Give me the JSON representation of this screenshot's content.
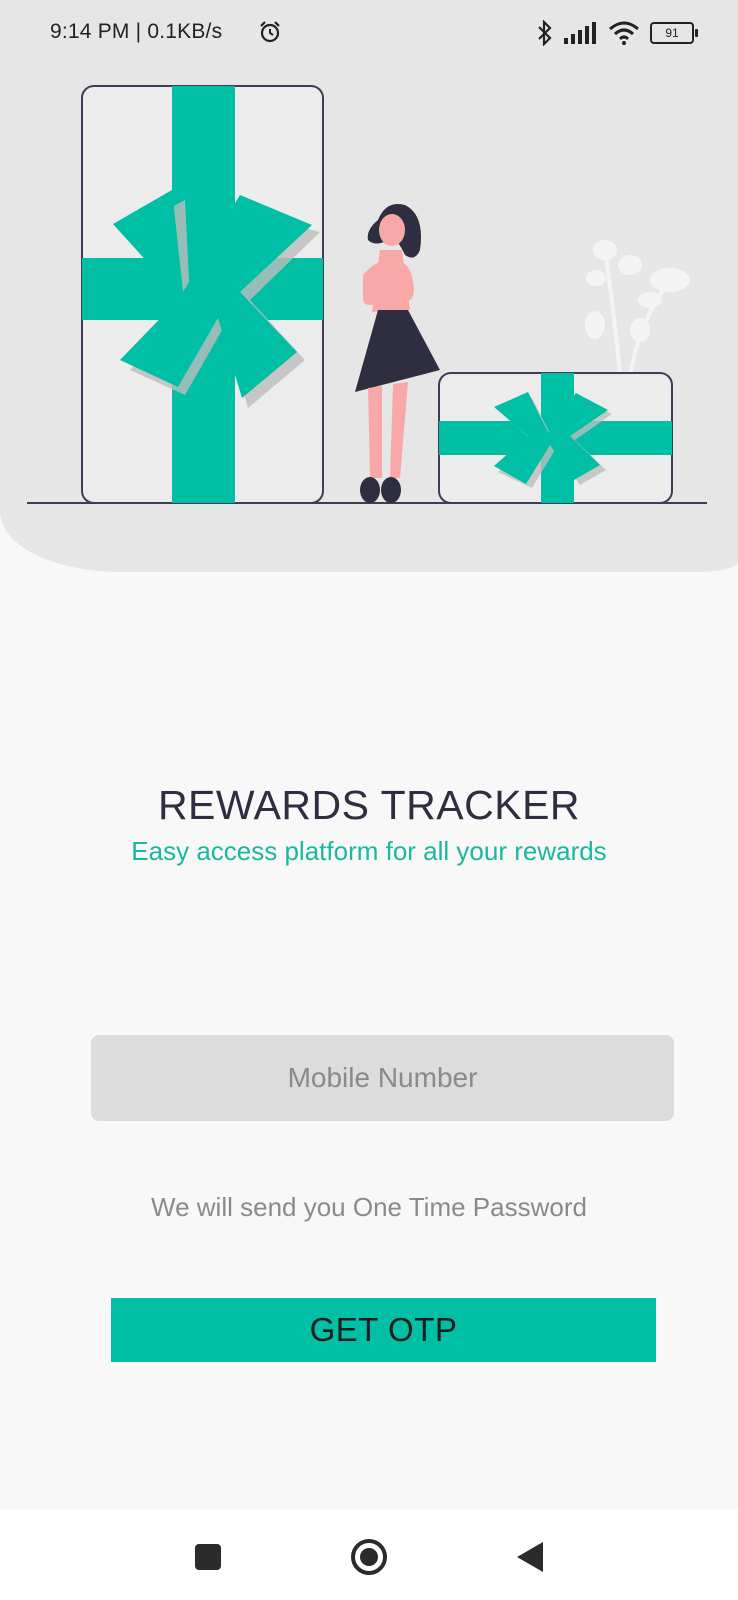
{
  "status_bar": {
    "time_speed": "9:14 PM | 0.1KB/s",
    "battery": "91"
  },
  "app": {
    "title": "REWARDS TRACKER",
    "subtitle": "Easy access platform for all your rewards"
  },
  "form": {
    "mobile_placeholder": "Mobile Number",
    "mobile_value": "",
    "hint": "We will send you One Time Password",
    "button_label": "GET OTP"
  },
  "nav": {
    "items": [
      "recents-square-icon",
      "home-circle-icon",
      "back-triangle-icon"
    ]
  },
  "colors": {
    "accent": "#00bfa5",
    "accent_text": "#1ab8a0",
    "title_text": "#2f2e41",
    "hero_bg": "#e6e6e6",
    "input_bg": "#dcdcdc"
  }
}
